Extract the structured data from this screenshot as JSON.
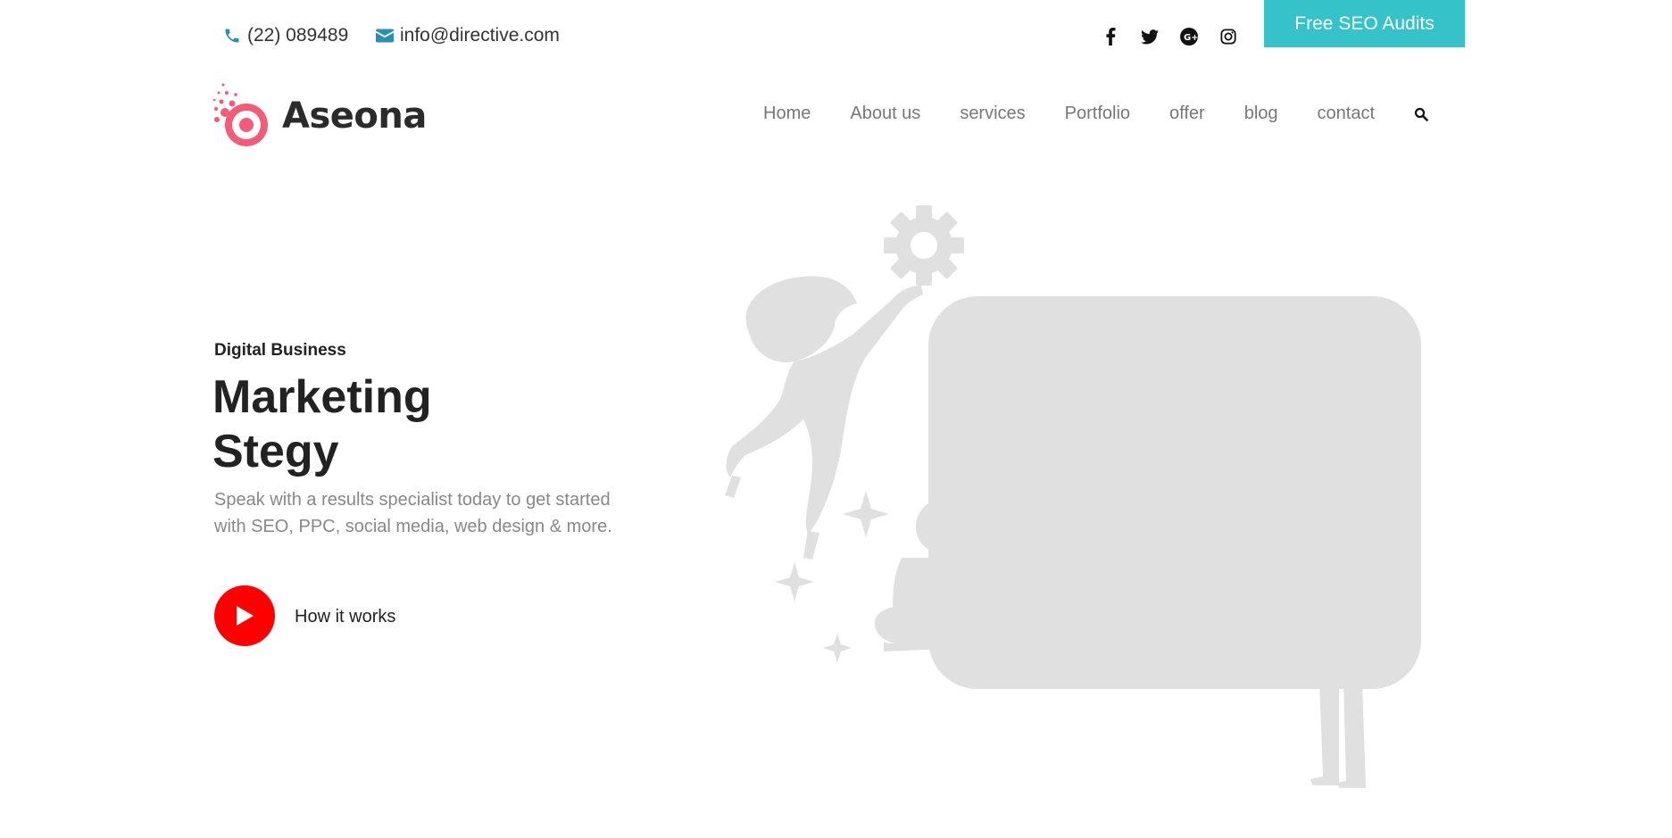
{
  "topbar": {
    "phone": "(22) 089489",
    "email": "info@directive.com",
    "socials": [
      "facebook-icon",
      "twitter-icon",
      "google-plus-icon",
      "instagram-icon"
    ],
    "cta_label": "Free SEO Audits"
  },
  "brand": {
    "name": "Aseona",
    "accent": "#f25c78"
  },
  "nav": {
    "items": [
      "Home",
      "About us",
      "services",
      "Portfolio",
      "offer",
      "blog",
      "contact"
    ]
  },
  "hero": {
    "eyebrow": "Digital Business",
    "title_line1": "Marketing",
    "title_line2": "Stegy",
    "description": "Speak with a results specialist today to get started with SEO, PPC, social media, web design & more.",
    "video_label": "How it works"
  },
  "colors": {
    "cta": "#36c2c9",
    "play": "#ff0000",
    "contact_icon": "#2a8fb5",
    "illustration": "#e0e0e0"
  }
}
